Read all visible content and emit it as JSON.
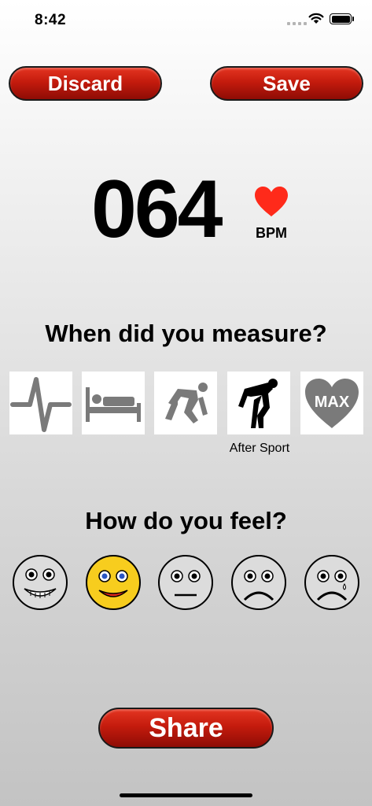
{
  "status_bar": {
    "time": "8:42"
  },
  "toolbar": {
    "discard_label": "Discard",
    "save_label": "Save"
  },
  "measurement": {
    "bpm_value": "064",
    "unit": "BPM"
  },
  "when_section": {
    "title": "When did you measure?",
    "options": [
      {
        "icon": "heartbeat-line-icon"
      },
      {
        "icon": "bed-rest-icon"
      },
      {
        "icon": "sprinter-start-icon"
      },
      {
        "icon": "after-sport-icon",
        "label": "After Sport",
        "selected": true
      },
      {
        "icon": "max-heart-icon",
        "text": "MAX"
      }
    ]
  },
  "feel_section": {
    "title": "How do you feel?",
    "options": [
      {
        "icon": "grinning-face-icon"
      },
      {
        "icon": "smiling-face-icon",
        "selected": true
      },
      {
        "icon": "neutral-face-icon"
      },
      {
        "icon": "sad-face-icon"
      },
      {
        "icon": "crying-face-icon"
      }
    ]
  },
  "share": {
    "label": "Share"
  },
  "colors": {
    "button_red": "#c41b0d",
    "heart_red": "#ff2a1a",
    "selected_face": "#f7cd1e",
    "icon_gray": "#7a7a7a"
  }
}
